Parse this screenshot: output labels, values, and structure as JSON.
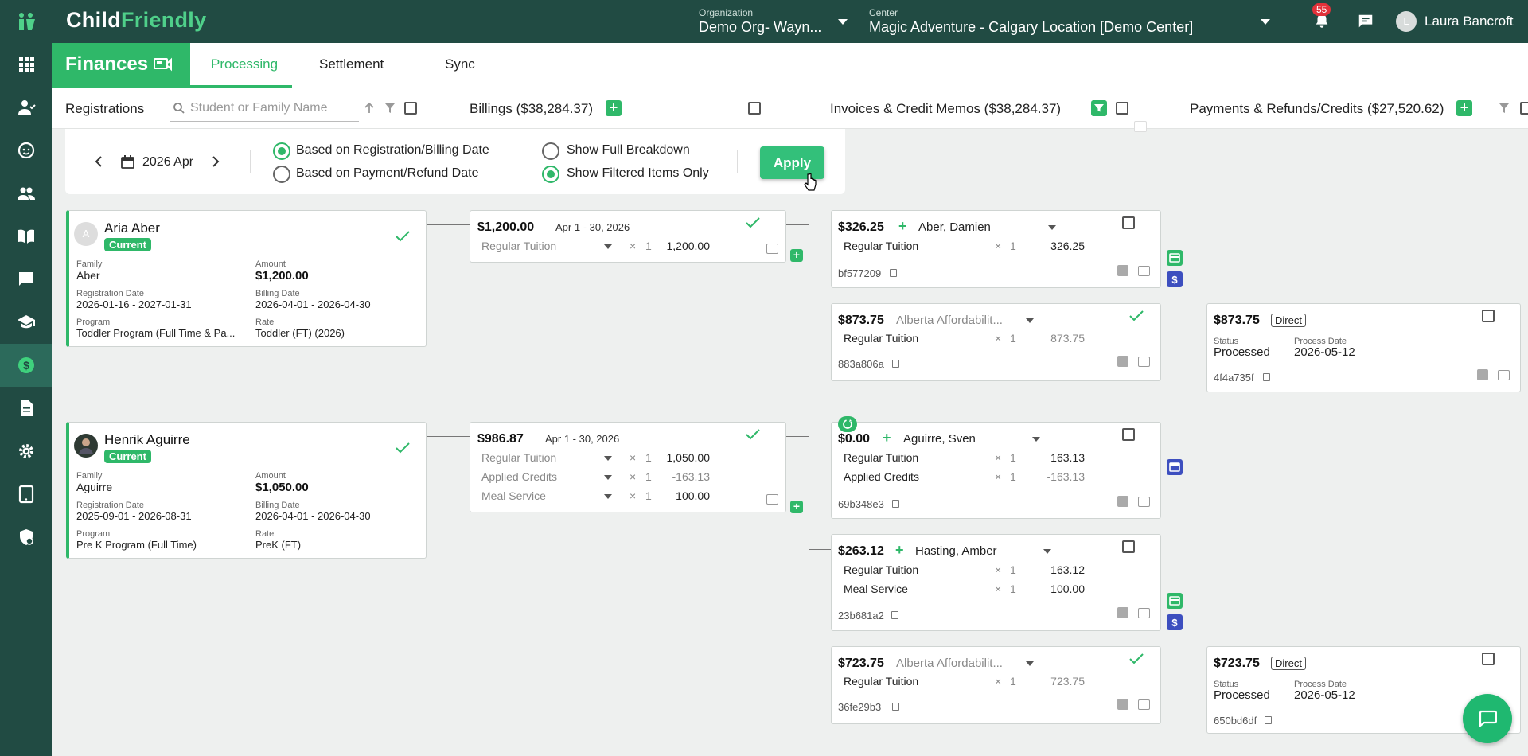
{
  "brand": {
    "part1": "Child",
    "part2": "Friendly"
  },
  "topbar": {
    "org_label": "Organization",
    "org_value": "Demo Org- Wayn...",
    "center_label": "Center",
    "center_value": "Magic Adventure - Calgary Location [Demo Center]",
    "notifications": "55",
    "avatar_letter": "L",
    "user_name": "Laura Bancroft"
  },
  "sidebar": {
    "items": [
      "apps-icon",
      "child-icon",
      "face-icon",
      "people-icon",
      "book-icon",
      "message-icon",
      "school-icon",
      "finance-icon",
      "document-icon",
      "settings-icon",
      "tablet-icon",
      "shield-icon"
    ],
    "active": "finance-icon"
  },
  "section": {
    "title": "Finances",
    "tabs": [
      {
        "label": "Processing",
        "active": true
      },
      {
        "label": "Settlement"
      },
      {
        "label": "Sync"
      }
    ]
  },
  "filter_row": {
    "registrations": "Registrations",
    "search_placeholder": "Student or Family Name",
    "billings": "Billings ($38,284.37)",
    "invoices": "Invoices & Credit Memos ($38,284.37)",
    "payments": "Payments & Refunds/Credits ($27,520.62)"
  },
  "options": {
    "period": "2026 Apr",
    "radio_reg_billing": "Based on Registration/Billing Date",
    "radio_payment": "Based on Payment/Refund Date",
    "radio_full": "Show Full Breakdown",
    "radio_filtered": "Show Filtered Items Only",
    "apply": "Apply"
  },
  "registrations": [
    {
      "avatar": "A",
      "name": "Aria Aber",
      "status": "Current",
      "family_label": "Family",
      "family": "Aber",
      "amount_label": "Amount",
      "amount": "$1,200.00",
      "reg_date_label": "Registration Date",
      "reg_date": "2026-01-16 - 2027-01-31",
      "billing_date_label": "Billing Date",
      "billing_date": "2026-04-01 - 2026-04-30",
      "program_label": "Program",
      "program": "Toddler Program (Full Time & Pa...",
      "rate_label": "Rate",
      "rate": "Toddler (FT) (2026)"
    },
    {
      "avatar": "",
      "name": "Henrik Aguirre",
      "status": "Current",
      "family_label": "Family",
      "family": "Aguirre",
      "amount_label": "Amount",
      "amount": "$1,050.00",
      "reg_date_label": "Registration Date",
      "reg_date": "2025-09-01 - 2026-08-31",
      "billing_date_label": "Billing Date",
      "billing_date": "2026-04-01 - 2026-04-30",
      "program_label": "Program",
      "program": "Pre K Program (Full Time)",
      "rate_label": "Rate",
      "rate": "PreK (FT)"
    }
  ],
  "billings": [
    {
      "amount": "$1,200.00",
      "period": "Apr 1 - 30, 2026",
      "lines": [
        {
          "name": "Regular Tuition",
          "mult": "×",
          "qty": "1",
          "value": "1,200.00"
        }
      ]
    },
    {
      "amount": "$986.87",
      "period": "Apr 1 - 30, 2026",
      "lines": [
        {
          "name": "Regular Tuition",
          "mult": "×",
          "qty": "1",
          "value": "1,050.00"
        },
        {
          "name": "Applied Credits",
          "mult": "×",
          "qty": "1",
          "value": "-163.13"
        },
        {
          "name": "Meal Service",
          "mult": "×",
          "qty": "1",
          "value": "100.00"
        }
      ]
    }
  ],
  "invoices": [
    {
      "amount": "$326.25",
      "who": "Aber, Damien",
      "lines": [
        {
          "name": "Regular Tuition",
          "mult": "×",
          "qty": "1",
          "value": "326.25"
        }
      ],
      "code": "bf577209"
    },
    {
      "amount": "$873.75",
      "who": "Alberta Affordabilit...",
      "lines": [
        {
          "name": "Regular Tuition",
          "mult": "×",
          "qty": "1",
          "value": "873.75"
        }
      ],
      "code": "883a806a"
    },
    {
      "amount": "$0.00",
      "who": "Aguirre, Sven",
      "lines": [
        {
          "name": "Regular Tuition",
          "mult": "×",
          "qty": "1",
          "value": "163.13"
        },
        {
          "name": "Applied Credits",
          "mult": "×",
          "qty": "1",
          "value": "-163.13"
        }
      ],
      "code": "69b348e3"
    },
    {
      "amount": "$263.12",
      "who": "Hasting, Amber",
      "lines": [
        {
          "name": "Regular Tuition",
          "mult": "×",
          "qty": "1",
          "value": "163.12"
        },
        {
          "name": "Meal Service",
          "mult": "×",
          "qty": "1",
          "value": "100.00"
        }
      ],
      "code": "23b681a2"
    },
    {
      "amount": "$723.75",
      "who": "Alberta Affordabilit...",
      "lines": [
        {
          "name": "Regular Tuition",
          "mult": "×",
          "qty": "1",
          "value": "723.75"
        }
      ],
      "code": "36fe29b3"
    }
  ],
  "payments": [
    {
      "amount": "$873.75",
      "type": "Direct",
      "status_label": "Status",
      "status": "Processed",
      "date_label": "Process Date",
      "date": "2026-05-12",
      "code": "4f4a735f"
    },
    {
      "amount": "$723.75",
      "type": "Direct",
      "status_label": "Status",
      "status": "Processed",
      "date_label": "Process Date",
      "date": "2026-05-12",
      "code": "650bd6df"
    }
  ],
  "colors": {
    "brand_green": "#2fb869",
    "sidebar": "#214b43",
    "badge_red": "#e2323a",
    "invoice_badge_blue": "#3d4fbf"
  }
}
